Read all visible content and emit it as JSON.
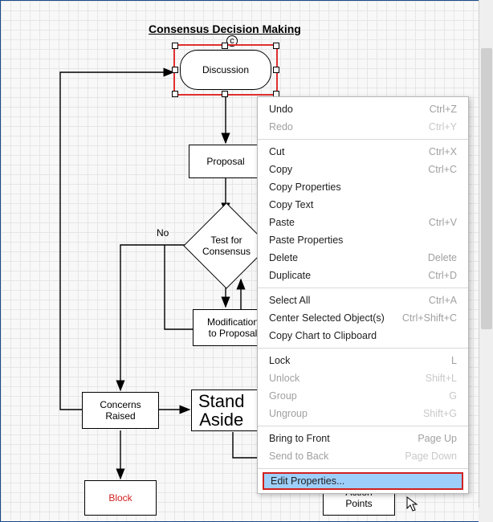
{
  "title": "Consensus Decision Making",
  "nodes": {
    "discussion": "Discussion",
    "proposal": "Proposal",
    "test": "Test for\nConsensus",
    "mod": "Modification\nto Proposal",
    "stand": "Stand\nAside",
    "concerns": "Concerns\nRaised",
    "block": "Block",
    "action": "Action\nPoints"
  },
  "labels": {
    "no": "No"
  },
  "menu": {
    "undo": {
      "label": "Undo",
      "shortcut": "Ctrl+Z",
      "enabled": true
    },
    "redo": {
      "label": "Redo",
      "shortcut": "Ctrl+Y",
      "enabled": false
    },
    "cut": {
      "label": "Cut",
      "shortcut": "Ctrl+X",
      "enabled": true
    },
    "copy": {
      "label": "Copy",
      "shortcut": "Ctrl+C",
      "enabled": true
    },
    "copyProps": {
      "label": "Copy Properties",
      "shortcut": "",
      "enabled": true
    },
    "copyText": {
      "label": "Copy Text",
      "shortcut": "",
      "enabled": true
    },
    "paste": {
      "label": "Paste",
      "shortcut": "Ctrl+V",
      "enabled": true
    },
    "pasteProps": {
      "label": "Paste Properties",
      "shortcut": "",
      "enabled": true
    },
    "delete": {
      "label": "Delete",
      "shortcut": "Delete",
      "enabled": true
    },
    "duplicate": {
      "label": "Duplicate",
      "shortcut": "Ctrl+D",
      "enabled": true
    },
    "selectAll": {
      "label": "Select All",
      "shortcut": "Ctrl+A",
      "enabled": true
    },
    "center": {
      "label": "Center Selected Object(s)",
      "shortcut": "Ctrl+Shift+C",
      "enabled": true
    },
    "copyChart": {
      "label": "Copy Chart to Clipboard",
      "shortcut": "",
      "enabled": true
    },
    "lock": {
      "label": "Lock",
      "shortcut": "L",
      "enabled": true
    },
    "unlock": {
      "label": "Unlock",
      "shortcut": "Shift+L",
      "enabled": false
    },
    "group": {
      "label": "Group",
      "shortcut": "G",
      "enabled": false
    },
    "ungroup": {
      "label": "Ungroup",
      "shortcut": "Shift+G",
      "enabled": false
    },
    "front": {
      "label": "Bring to Front",
      "shortcut": "Page Up",
      "enabled": true
    },
    "back": {
      "label": "Send to Back",
      "shortcut": "Page Down",
      "enabled": false
    },
    "editProps": {
      "label": "Edit Properties...",
      "shortcut": "",
      "enabled": true
    }
  }
}
